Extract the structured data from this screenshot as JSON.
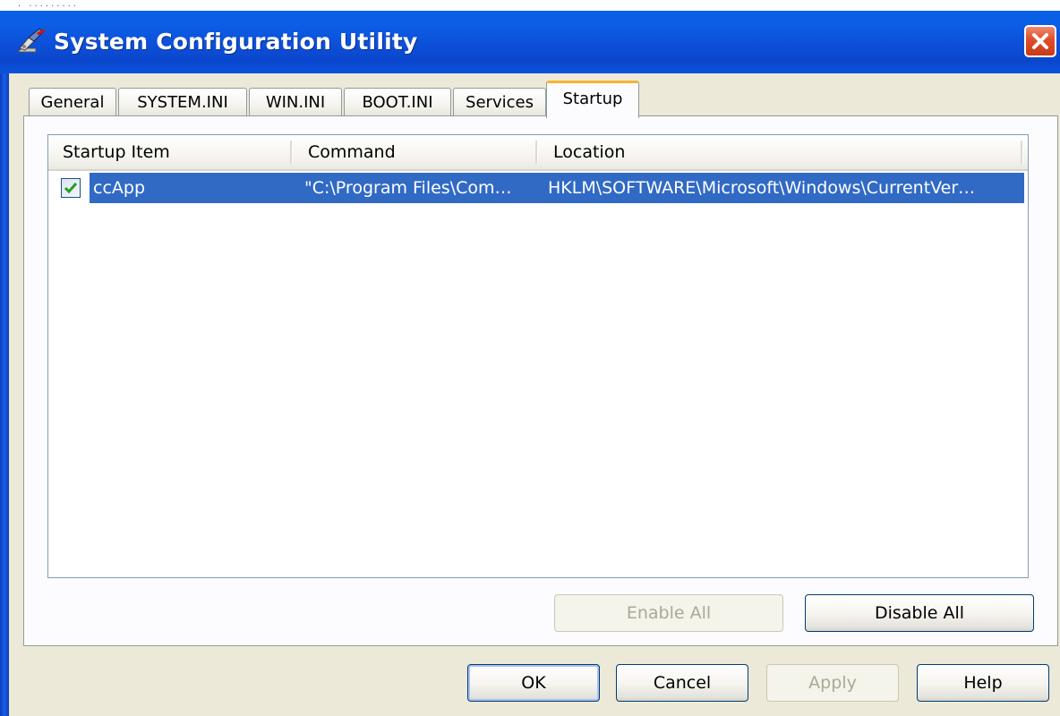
{
  "window": {
    "title": "System Configuration Utility",
    "icons": {
      "app": "msconfig-icon",
      "close": "close-icon"
    }
  },
  "tabs": [
    {
      "label": "General",
      "active": false
    },
    {
      "label": "SYSTEM.INI",
      "active": false
    },
    {
      "label": "WIN.INI",
      "active": false
    },
    {
      "label": "BOOT.INI",
      "active": false
    },
    {
      "label": "Services",
      "active": false
    },
    {
      "label": "Startup",
      "active": true
    }
  ],
  "startup_list": {
    "columns": [
      "Startup Item",
      "Command",
      "Location"
    ],
    "rows": [
      {
        "checked": true,
        "selected": true,
        "item": "ccApp",
        "command": "\"C:\\Program Files\\Com…",
        "location": "HKLM\\SOFTWARE\\Microsoft\\Windows\\CurrentVer…"
      }
    ]
  },
  "list_buttons": {
    "enable_all": "Enable All",
    "disable_all": "Disable All"
  },
  "dialog_buttons": {
    "ok": "OK",
    "cancel": "Cancel",
    "apply": "Apply",
    "help": "Help"
  },
  "colors": {
    "titlebar": "#0b53dc",
    "selection": "#316ac5",
    "dialog_bg": "#ece9d8",
    "active_tab_accent": "#f7b432",
    "close_button": "#dd4e2a"
  }
}
